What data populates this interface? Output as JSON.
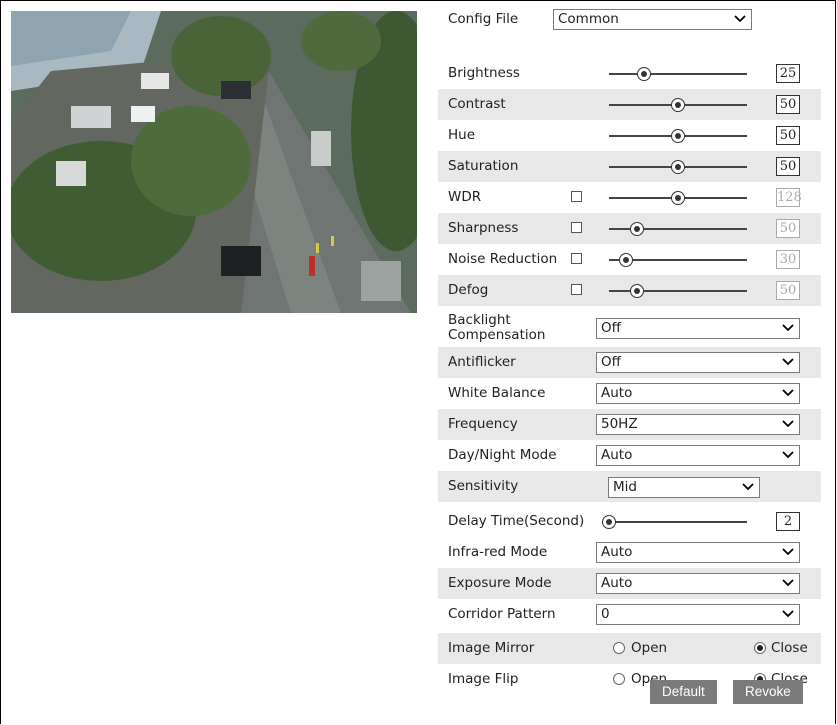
{
  "config_file": {
    "label": "Config File",
    "value": "Common"
  },
  "sliders": [
    {
      "label": "Brightness",
      "value": "25",
      "level": 0.25,
      "checkbox": false,
      "enabled": true
    },
    {
      "label": "Contrast",
      "value": "50",
      "level": 0.5,
      "checkbox": false,
      "enabled": true
    },
    {
      "label": "Hue",
      "value": "50",
      "level": 0.5,
      "checkbox": false,
      "enabled": true
    },
    {
      "label": "Saturation",
      "value": "50",
      "level": 0.5,
      "checkbox": false,
      "enabled": true
    },
    {
      "label": "WDR",
      "value": "128",
      "level": 0.5,
      "checkbox": true,
      "enabled": false
    },
    {
      "label": "Sharpness",
      "value": "50",
      "level": 0.2,
      "checkbox": true,
      "enabled": false
    },
    {
      "label": "Noise Reduction",
      "value": "30",
      "level": 0.12,
      "checkbox": true,
      "enabled": false
    },
    {
      "label": "Defog",
      "value": "50",
      "level": 0.2,
      "checkbox": true,
      "enabled": false
    }
  ],
  "selects": {
    "backlight": {
      "label": "Backlight Compensation",
      "value": "Off"
    },
    "antiflicker": {
      "label": "Antiflicker",
      "value": "Off"
    },
    "white_balance": {
      "label": "White Balance",
      "value": "Auto"
    },
    "frequency": {
      "label": "Frequency",
      "value": "50HZ"
    },
    "day_night": {
      "label": "Day/Night Mode",
      "value": "Auto"
    },
    "sensitivity": {
      "label": "Sensitivity",
      "value": "Mid"
    }
  },
  "delay": {
    "label": "Delay Time(Second)",
    "value": "2",
    "level": 0.0
  },
  "selects2": {
    "infrared": {
      "label": "Infra-red Mode",
      "value": "Auto"
    },
    "exposure": {
      "label": "Exposure Mode",
      "value": "Auto"
    },
    "corridor": {
      "label": "Corridor Pattern",
      "value": "0"
    }
  },
  "mirror": {
    "label": "Image Mirror",
    "open": "Open",
    "close": "Close",
    "selected": "Close"
  },
  "flip": {
    "label": "Image Flip",
    "open": "Open",
    "close": "Close",
    "selected": "Close"
  },
  "buttons": {
    "default": "Default",
    "revoke": "Revoke"
  }
}
